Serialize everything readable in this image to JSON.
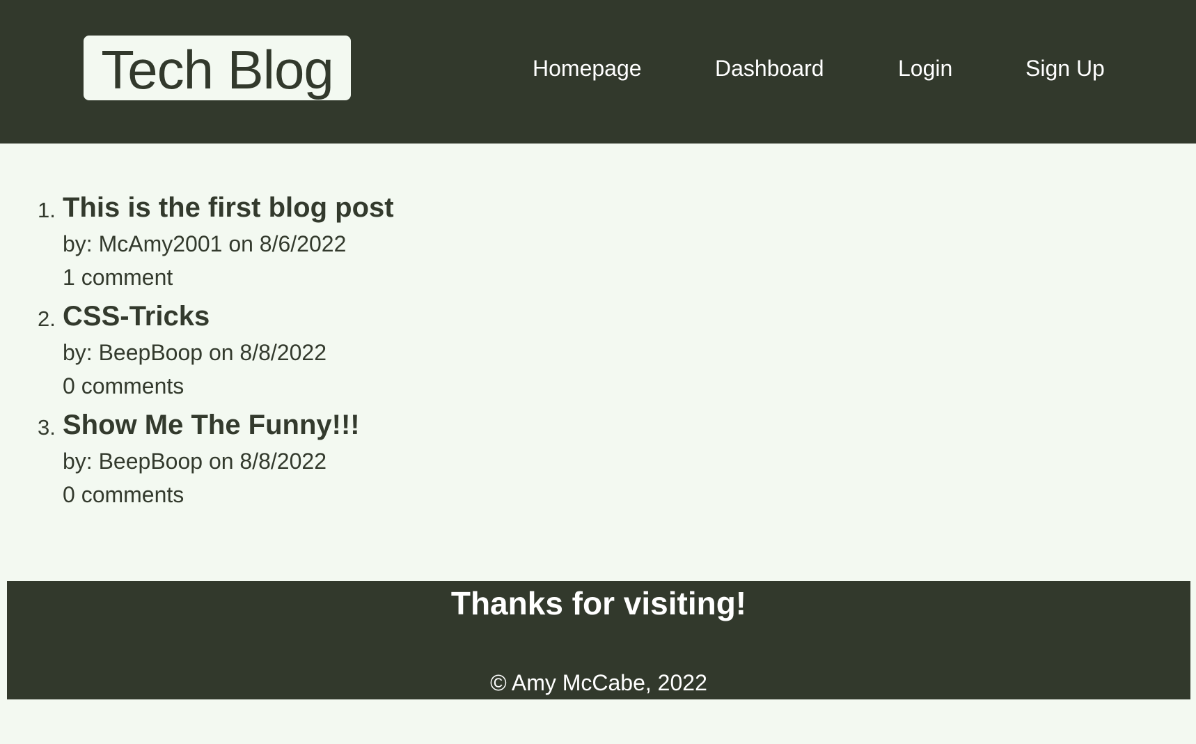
{
  "header": {
    "logo_text": "Tech Blog",
    "nav": [
      {
        "label": "Homepage"
      },
      {
        "label": "Dashboard"
      },
      {
        "label": "Login"
      },
      {
        "label": "Sign Up"
      }
    ]
  },
  "posts": [
    {
      "number": "1.",
      "title": "This is the first blog post",
      "meta": "by: McAmy2001 on 8/6/2022",
      "comments": "1 comment"
    },
    {
      "number": "2.",
      "title": "CSS-Tricks",
      "meta": "by: BeepBoop on 8/8/2022",
      "comments": "0 comments"
    },
    {
      "number": "3.",
      "title": "Show Me The Funny!!!",
      "meta": "by: BeepBoop on 8/8/2022",
      "comments": "0 comments"
    }
  ],
  "footer": {
    "heading": "Thanks for visiting!",
    "copyright": "© Amy McCabe, 2022"
  },
  "colors": {
    "dark": "#32392c",
    "background": "#f3f9f1",
    "text": "#333a2d"
  }
}
